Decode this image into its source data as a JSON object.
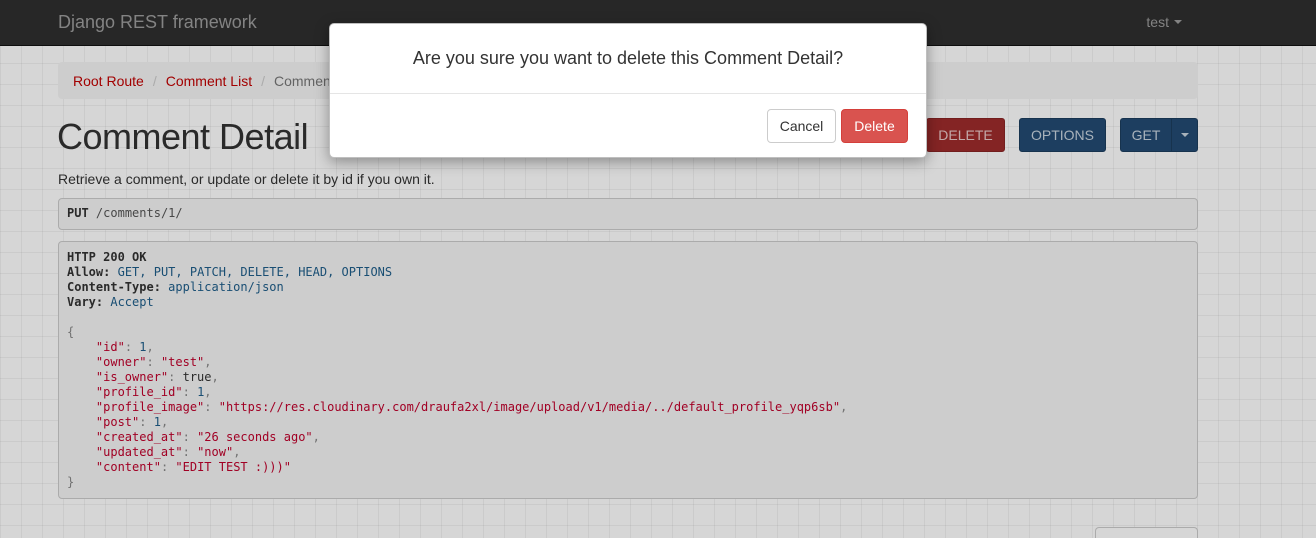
{
  "navbar": {
    "brand": "Django REST framework",
    "user": "test"
  },
  "breadcrumb": {
    "items": [
      "Root Route",
      "Comment List"
    ],
    "active": "Comment Detail"
  },
  "page": {
    "title": "Comment Detail",
    "description": "Retrieve a comment, or update or delete it by id if you own it."
  },
  "actions": {
    "delete_label": "DELETE",
    "options_label": "OPTIONS",
    "get_label": "GET"
  },
  "request": {
    "method": "PUT",
    "url": "/comments/1/"
  },
  "response": {
    "status": "HTTP 200 OK",
    "headers": [
      {
        "name": "Allow:",
        "value": "GET, PUT, PATCH, DELETE, HEAD, OPTIONS"
      },
      {
        "name": "Content-Type:",
        "value": "application/json"
      },
      {
        "name": "Vary:",
        "value": "Accept"
      }
    ],
    "open_brace": "{",
    "close_brace": "}",
    "body": [
      {
        "key": "\"id\"",
        "value": "1",
        "type": "n"
      },
      {
        "key": "\"owner\"",
        "value": "\"test\"",
        "type": "s"
      },
      {
        "key": "\"is_owner\"",
        "value": "true",
        "type": "b"
      },
      {
        "key": "\"profile_id\"",
        "value": "1",
        "type": "n"
      },
      {
        "key": "\"profile_image\"",
        "value": "\"https://res.cloudinary.com/draufa2xl/image/upload/v1/media/../default_profile_yqp6sb\"",
        "type": "s"
      },
      {
        "key": "\"post\"",
        "value": "1",
        "type": "n"
      },
      {
        "key": "\"created_at\"",
        "value": "\"26 seconds ago\"",
        "type": "s"
      },
      {
        "key": "\"updated_at\"",
        "value": "\"now\"",
        "type": "s"
      },
      {
        "key": "\"content\"",
        "value": "\"EDIT TEST :)))\"",
        "type": "s"
      }
    ]
  },
  "modal": {
    "title": "Are you sure you want to delete this Comment Detail?",
    "cancel_label": "Cancel",
    "delete_label": "Delete"
  }
}
